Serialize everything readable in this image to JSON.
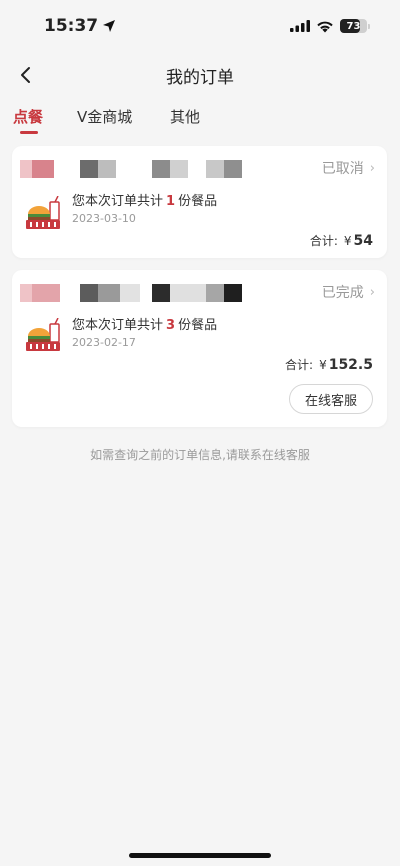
{
  "status_bar": {
    "time": "15:37",
    "battery": "73",
    "battery_level": 0.73
  },
  "nav": {
    "title": "我的订单"
  },
  "tabs": [
    {
      "label": "点餐",
      "active": true
    },
    {
      "label": "V金商城",
      "active": false
    },
    {
      "label": "其他",
      "active": false
    }
  ],
  "orders": [
    {
      "status": "已取消",
      "summary_prefix": "您本次订单共计",
      "count": "1",
      "summary_suffix": "份餐品",
      "date": "2023-03-10",
      "total_label": "合计:",
      "currency": "¥",
      "amount": "54"
    },
    {
      "status": "已完成",
      "summary_prefix": "您本次订单共计",
      "count": "3",
      "summary_suffix": "份餐品",
      "date": "2023-02-17",
      "total_label": "合计:",
      "currency": "¥",
      "amount": "152.5",
      "action_label": "在线客服"
    }
  ],
  "footer_note": "如需查询之前的订单信息,请联系在线客服",
  "colors": {
    "accent": "#c8393f",
    "background": "#f5f5f5",
    "muted": "#9a9a9a"
  },
  "icons": {
    "location": "location-arrow-icon",
    "signal": "cellular-signal-icon",
    "wifi": "wifi-icon",
    "back": "chevron-left-icon",
    "food": "burger-meal-icon",
    "chevron": "chevron-right-icon"
  }
}
